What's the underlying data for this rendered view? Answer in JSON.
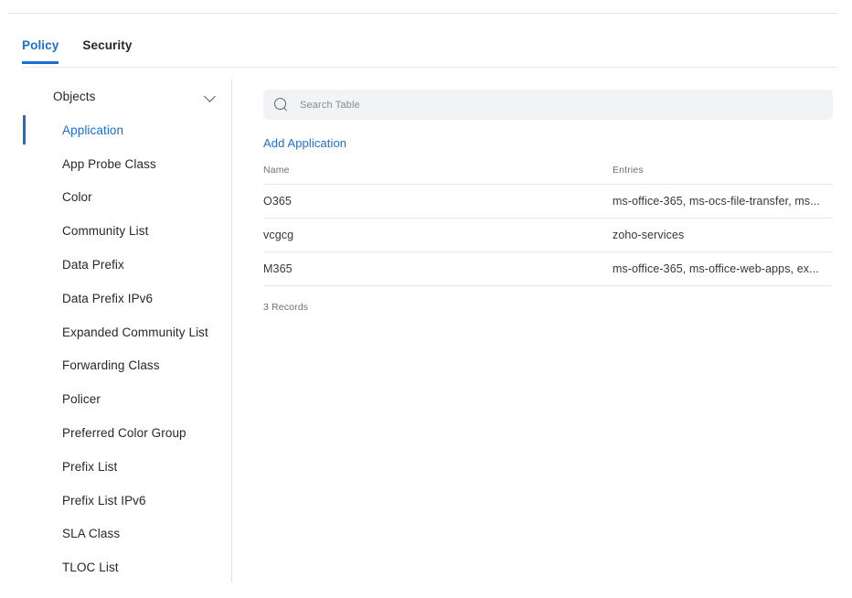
{
  "tabs": [
    {
      "label": "Policy",
      "active": true
    },
    {
      "label": "Security",
      "active": false
    }
  ],
  "sidebar": {
    "group_title": "Objects",
    "chevron_icon": "chevron-down-icon",
    "items": [
      {
        "label": "Application",
        "selected": true
      },
      {
        "label": "App Probe Class",
        "selected": false
      },
      {
        "label": "Color",
        "selected": false
      },
      {
        "label": "Community List",
        "selected": false
      },
      {
        "label": "Data Prefix",
        "selected": false
      },
      {
        "label": "Data Prefix IPv6",
        "selected": false
      },
      {
        "label": "Expanded Community List",
        "selected": false
      },
      {
        "label": "Forwarding Class",
        "selected": false
      },
      {
        "label": "Policer",
        "selected": false
      },
      {
        "label": "Preferred Color Group",
        "selected": false
      },
      {
        "label": "Prefix List",
        "selected": false
      },
      {
        "label": "Prefix List IPv6",
        "selected": false
      },
      {
        "label": "SLA Class",
        "selected": false
      },
      {
        "label": "TLOC List",
        "selected": false
      }
    ]
  },
  "search": {
    "icon": "search-icon",
    "placeholder": "Search Table",
    "value": ""
  },
  "actions": {
    "add_application_label": "Add Application"
  },
  "table": {
    "columns": [
      {
        "key": "name",
        "label": "Name"
      },
      {
        "key": "entries",
        "label": "Entries"
      }
    ],
    "rows": [
      {
        "name": "O365",
        "entries": "ms-office-365, ms-ocs-file-transfer, ms..."
      },
      {
        "name": "vcgcg",
        "entries": "zoho-services"
      },
      {
        "name": "M365",
        "entries": "ms-office-365, ms-office-web-apps, ex..."
      }
    ],
    "records_label": "3 Records"
  },
  "colors": {
    "accent": "#1a6fd4",
    "text": "#23282e",
    "muted": "#6a7078",
    "border": "#e6e9ec",
    "search_bg": "#f2f3f5"
  }
}
